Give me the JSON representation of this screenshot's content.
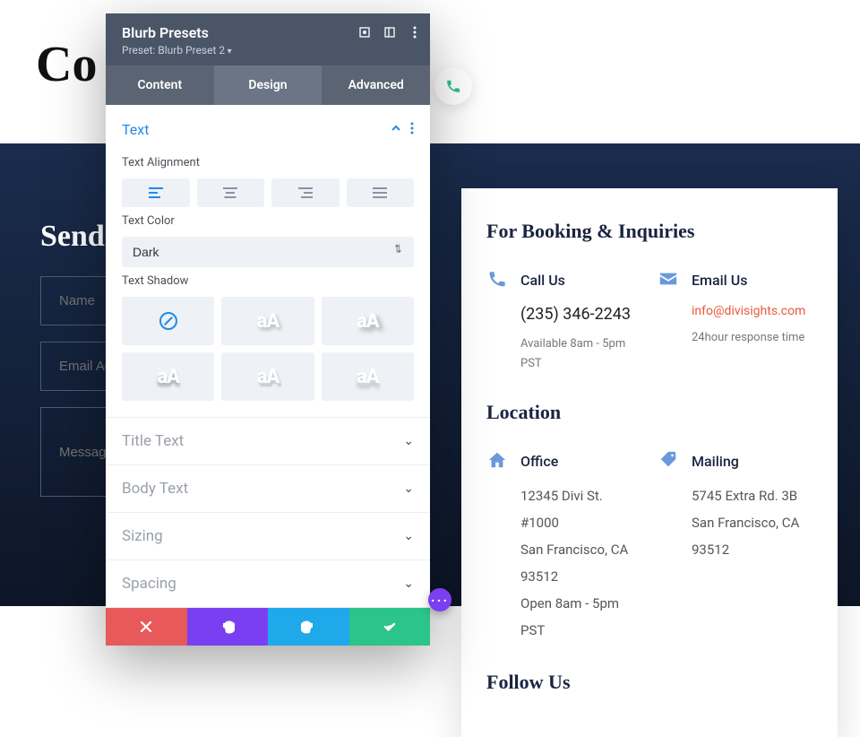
{
  "hero": {
    "title": "Co"
  },
  "form": {
    "heading": "Send",
    "name_placeholder": "Name",
    "email_placeholder": "Email Add",
    "message_placeholder": "Message"
  },
  "contact": {
    "heading": "For Booking & Inquiries",
    "call": {
      "title": "Call Us",
      "phone": "(235) 346-2243",
      "note": "Available 8am - 5pm PST"
    },
    "email": {
      "title": "Email Us",
      "address": "info@divisights.com",
      "note": "24hour response time"
    },
    "location_heading": "Location",
    "office": {
      "title": "Office",
      "line1": "12345 Divi St. #1000",
      "line2": "San Francisco, CA 93512",
      "line3": "Open 8am - 5pm PST"
    },
    "mailing": {
      "title": "Mailing",
      "line1": "5745 Extra Rd. 3B",
      "line2": "San Francisco, CA 93512"
    },
    "follow_heading": "Follow Us"
  },
  "modal": {
    "title": "Blurb Presets",
    "preset_label": "Preset: Blurb Preset 2",
    "tabs": {
      "content": "Content",
      "design": "Design",
      "advanced": "Advanced"
    },
    "text_section": "Text",
    "alignment_label": "Text Alignment",
    "color_label": "Text Color",
    "color_value": "Dark",
    "shadow_label": "Text Shadow",
    "closed": {
      "title_text": "Title Text",
      "body_text": "Body Text",
      "sizing": "Sizing",
      "spacing": "Spacing"
    }
  }
}
